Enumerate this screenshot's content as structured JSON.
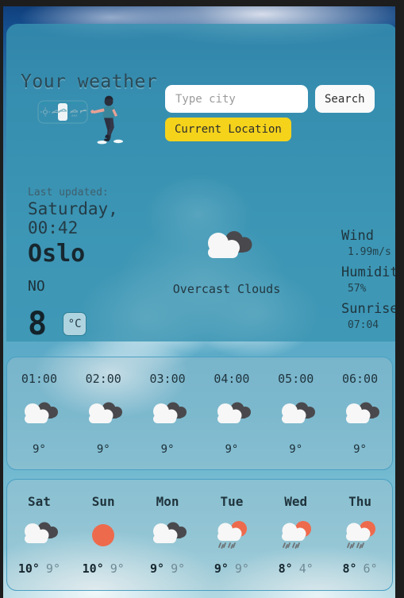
{
  "header": {
    "title": "Your weather",
    "illustration_name": "person-pointing-at-weather-widget"
  },
  "search": {
    "input_value": "",
    "placeholder": "Type city",
    "search_label": "Search",
    "current_location_label": "Current Location",
    "current_location_color": "#f5d31b"
  },
  "current": {
    "updated_label": "Last updated:",
    "updated_value": "Saturday, 00:42",
    "city": "Oslo",
    "country": "NO",
    "temperature": "8",
    "unit_label": "°C",
    "condition": "Overcast Clouds",
    "condition_icon": "overcast-clouds-icon",
    "stats": [
      {
        "name": "Wind",
        "value": "1.99m/s"
      },
      {
        "name": "Humidity",
        "value": "57%"
      },
      {
        "name": "Sunrise",
        "value": "07:04"
      }
    ]
  },
  "hourly": [
    {
      "time": "01:00",
      "icon": "overcast-clouds-icon",
      "temp": "9°"
    },
    {
      "time": "02:00",
      "icon": "overcast-clouds-icon",
      "temp": "9°"
    },
    {
      "time": "03:00",
      "icon": "overcast-clouds-icon",
      "temp": "9°"
    },
    {
      "time": "04:00",
      "icon": "overcast-clouds-icon",
      "temp": "9°"
    },
    {
      "time": "05:00",
      "icon": "overcast-clouds-icon",
      "temp": "9°"
    },
    {
      "time": "06:00",
      "icon": "overcast-clouds-icon",
      "temp": "9°"
    }
  ],
  "daily": [
    {
      "day": "Sat",
      "icon": "overcast-clouds-icon",
      "max": "10°",
      "min": "9°"
    },
    {
      "day": "Sun",
      "icon": "clear-sun-icon",
      "max": "10°",
      "min": "9°"
    },
    {
      "day": "Mon",
      "icon": "overcast-clouds-icon",
      "max": "9°",
      "min": "9°"
    },
    {
      "day": "Tue",
      "icon": "sun-cloud-rain-icon",
      "max": "9°",
      "min": "9°"
    },
    {
      "day": "Wed",
      "icon": "sun-cloud-rain-icon",
      "max": "8°",
      "min": "4°"
    },
    {
      "day": "Thu",
      "icon": "sun-cloud-rain-icon",
      "max": "8°",
      "min": "6°"
    }
  ],
  "colors": {
    "card_overlay": "#3893b1",
    "accent_yellow": "#f5d31b",
    "sun_orange": "#ee6a4d",
    "cloud_white": "#f7f7f7",
    "cloud_dark": "#49494d",
    "border_teal": "#4b9fc2"
  }
}
